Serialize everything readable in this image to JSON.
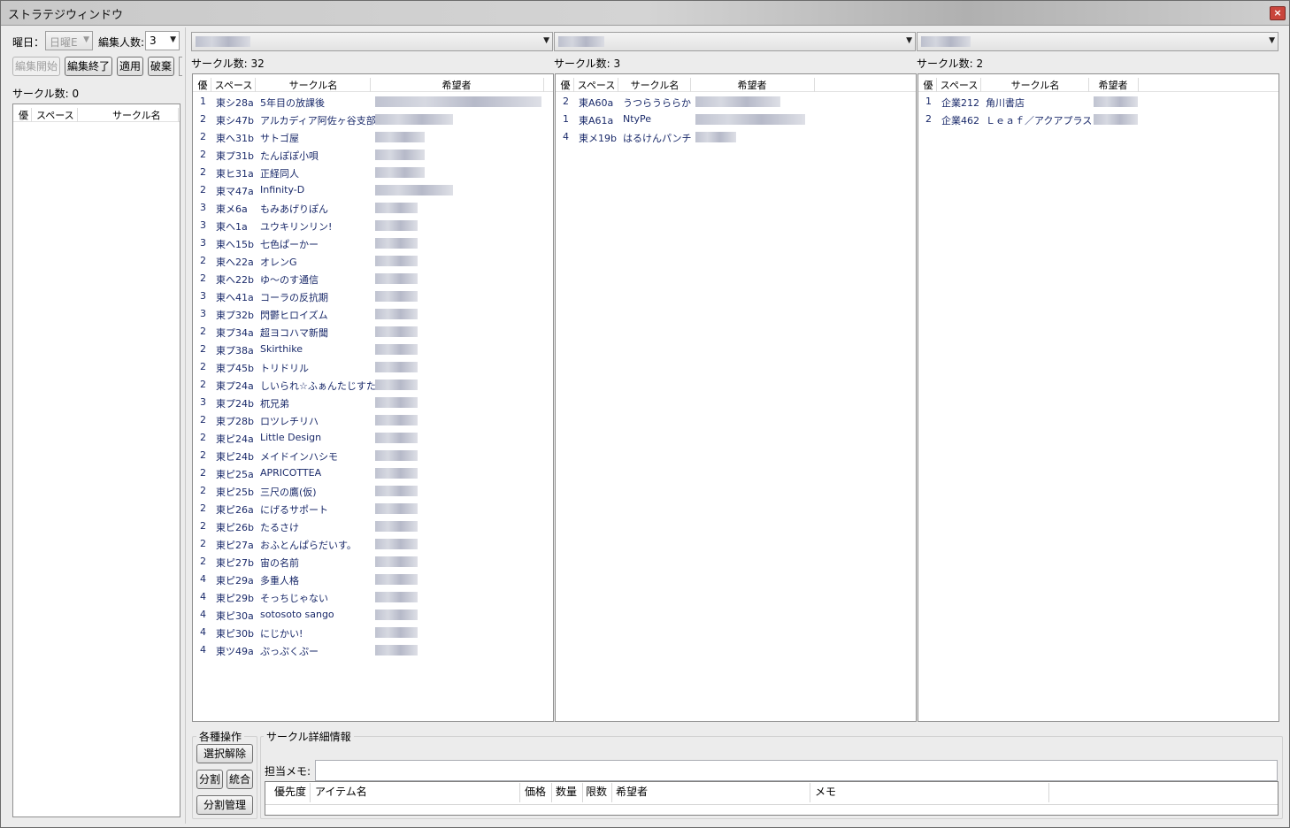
{
  "window": {
    "title": "ストラテジウィンドウ",
    "close_glyph": "×"
  },
  "left": {
    "weekday_label": "曜日：",
    "weekday_value": "日曜E",
    "editors_label": "編集人数:",
    "editors_value": "3",
    "buttons": {
      "start": "編集開始",
      "end": "編集終了",
      "apply": "適用",
      "discard": "破棄"
    },
    "circle_count_label": "サークル数: 0",
    "columns": [
      "優",
      "スペース",
      "サークル名"
    ]
  },
  "columns_headers": {
    "prio": "優",
    "space": "スペース",
    "name": "サークル名",
    "hope": "希望者"
  },
  "panels": [
    {
      "count_label": "サークル数: 32",
      "rows": [
        [
          "1",
          "東シ28a",
          "5年目の放課後"
        ],
        [
          "2",
          "東シ47b",
          "アルカディア阿佐ヶ谷支部"
        ],
        [
          "2",
          "東へ31b",
          "サトゴ屋"
        ],
        [
          "2",
          "東プ31b",
          "たんぽぽ小唄"
        ],
        [
          "2",
          "東ヒ31a",
          "正経同人"
        ],
        [
          "2",
          "東マ47a",
          "Infinity-D"
        ],
        [
          "3",
          "東メ6a",
          "もみあげりぽん"
        ],
        [
          "3",
          "東へ1a",
          "ユウキリンリン!"
        ],
        [
          "3",
          "東へ15b",
          "七色ぱーかー"
        ],
        [
          "2",
          "東へ22a",
          "オレンG"
        ],
        [
          "2",
          "東へ22b",
          "ゆ～のす通信"
        ],
        [
          "3",
          "東へ41a",
          "コーラの反抗期"
        ],
        [
          "3",
          "東プ32b",
          "閃鬱ヒロイズム"
        ],
        [
          "2",
          "東プ34a",
          "超ヨコハマ新聞"
        ],
        [
          "2",
          "東プ38a",
          "Skirthike"
        ],
        [
          "2",
          "東プ45b",
          "トリドリル"
        ],
        [
          "2",
          "東プ24a",
          "しいられ☆ふぁんたじすた"
        ],
        [
          "3",
          "東プ24b",
          "杌兄弟"
        ],
        [
          "2",
          "東プ28b",
          "ロツレチリハ"
        ],
        [
          "2",
          "東ピ24a",
          "Little Design"
        ],
        [
          "2",
          "東ピ24b",
          "メイドインハシモ"
        ],
        [
          "2",
          "東ピ25a",
          "APRICOTTEA"
        ],
        [
          "2",
          "東ピ25b",
          "三尺の鷹(仮)"
        ],
        [
          "2",
          "東ピ26a",
          "にげるサポート"
        ],
        [
          "2",
          "東ピ26b",
          "たるさけ"
        ],
        [
          "2",
          "東ピ27a",
          "おふとんぱらだいす。"
        ],
        [
          "2",
          "東ピ27b",
          "宙の名前"
        ],
        [
          "4",
          "東ピ29a",
          "多重人格"
        ],
        [
          "4",
          "東ピ29b",
          "そっちじゃない"
        ],
        [
          "4",
          "東ピ30a",
          "sotosoto sango"
        ],
        [
          "4",
          "東ピ30b",
          "にじかい!"
        ],
        [
          "4",
          "東ツ49a",
          "ぷっぷくぷー"
        ]
      ]
    },
    {
      "count_label": "サークル数: 3",
      "rows": [
        [
          "2",
          "東A60a",
          "うつらうららか"
        ],
        [
          "1",
          "東A61a",
          "NtyPe"
        ],
        [
          "4",
          "東メ19b",
          "はるけんパンチ"
        ]
      ]
    },
    {
      "count_label": "サークル数: 2",
      "rows": [
        [
          "1",
          "企業212",
          "角川書店"
        ],
        [
          "2",
          "企業462",
          "Ｌｅａｆ／アクアプラス"
        ]
      ]
    }
  ],
  "ops": {
    "group_label": "各種操作",
    "deselect": "選択解除",
    "split": "分割",
    "merge": "統合",
    "split_manage": "分割管理"
  },
  "detail": {
    "group_label": "サークル詳細情報",
    "memo_label": "担当メモ:",
    "memo_value": "",
    "columns": [
      "優先度",
      "アイテム名",
      "価格",
      "数量",
      "限数",
      "希望者",
      "メモ"
    ]
  }
}
